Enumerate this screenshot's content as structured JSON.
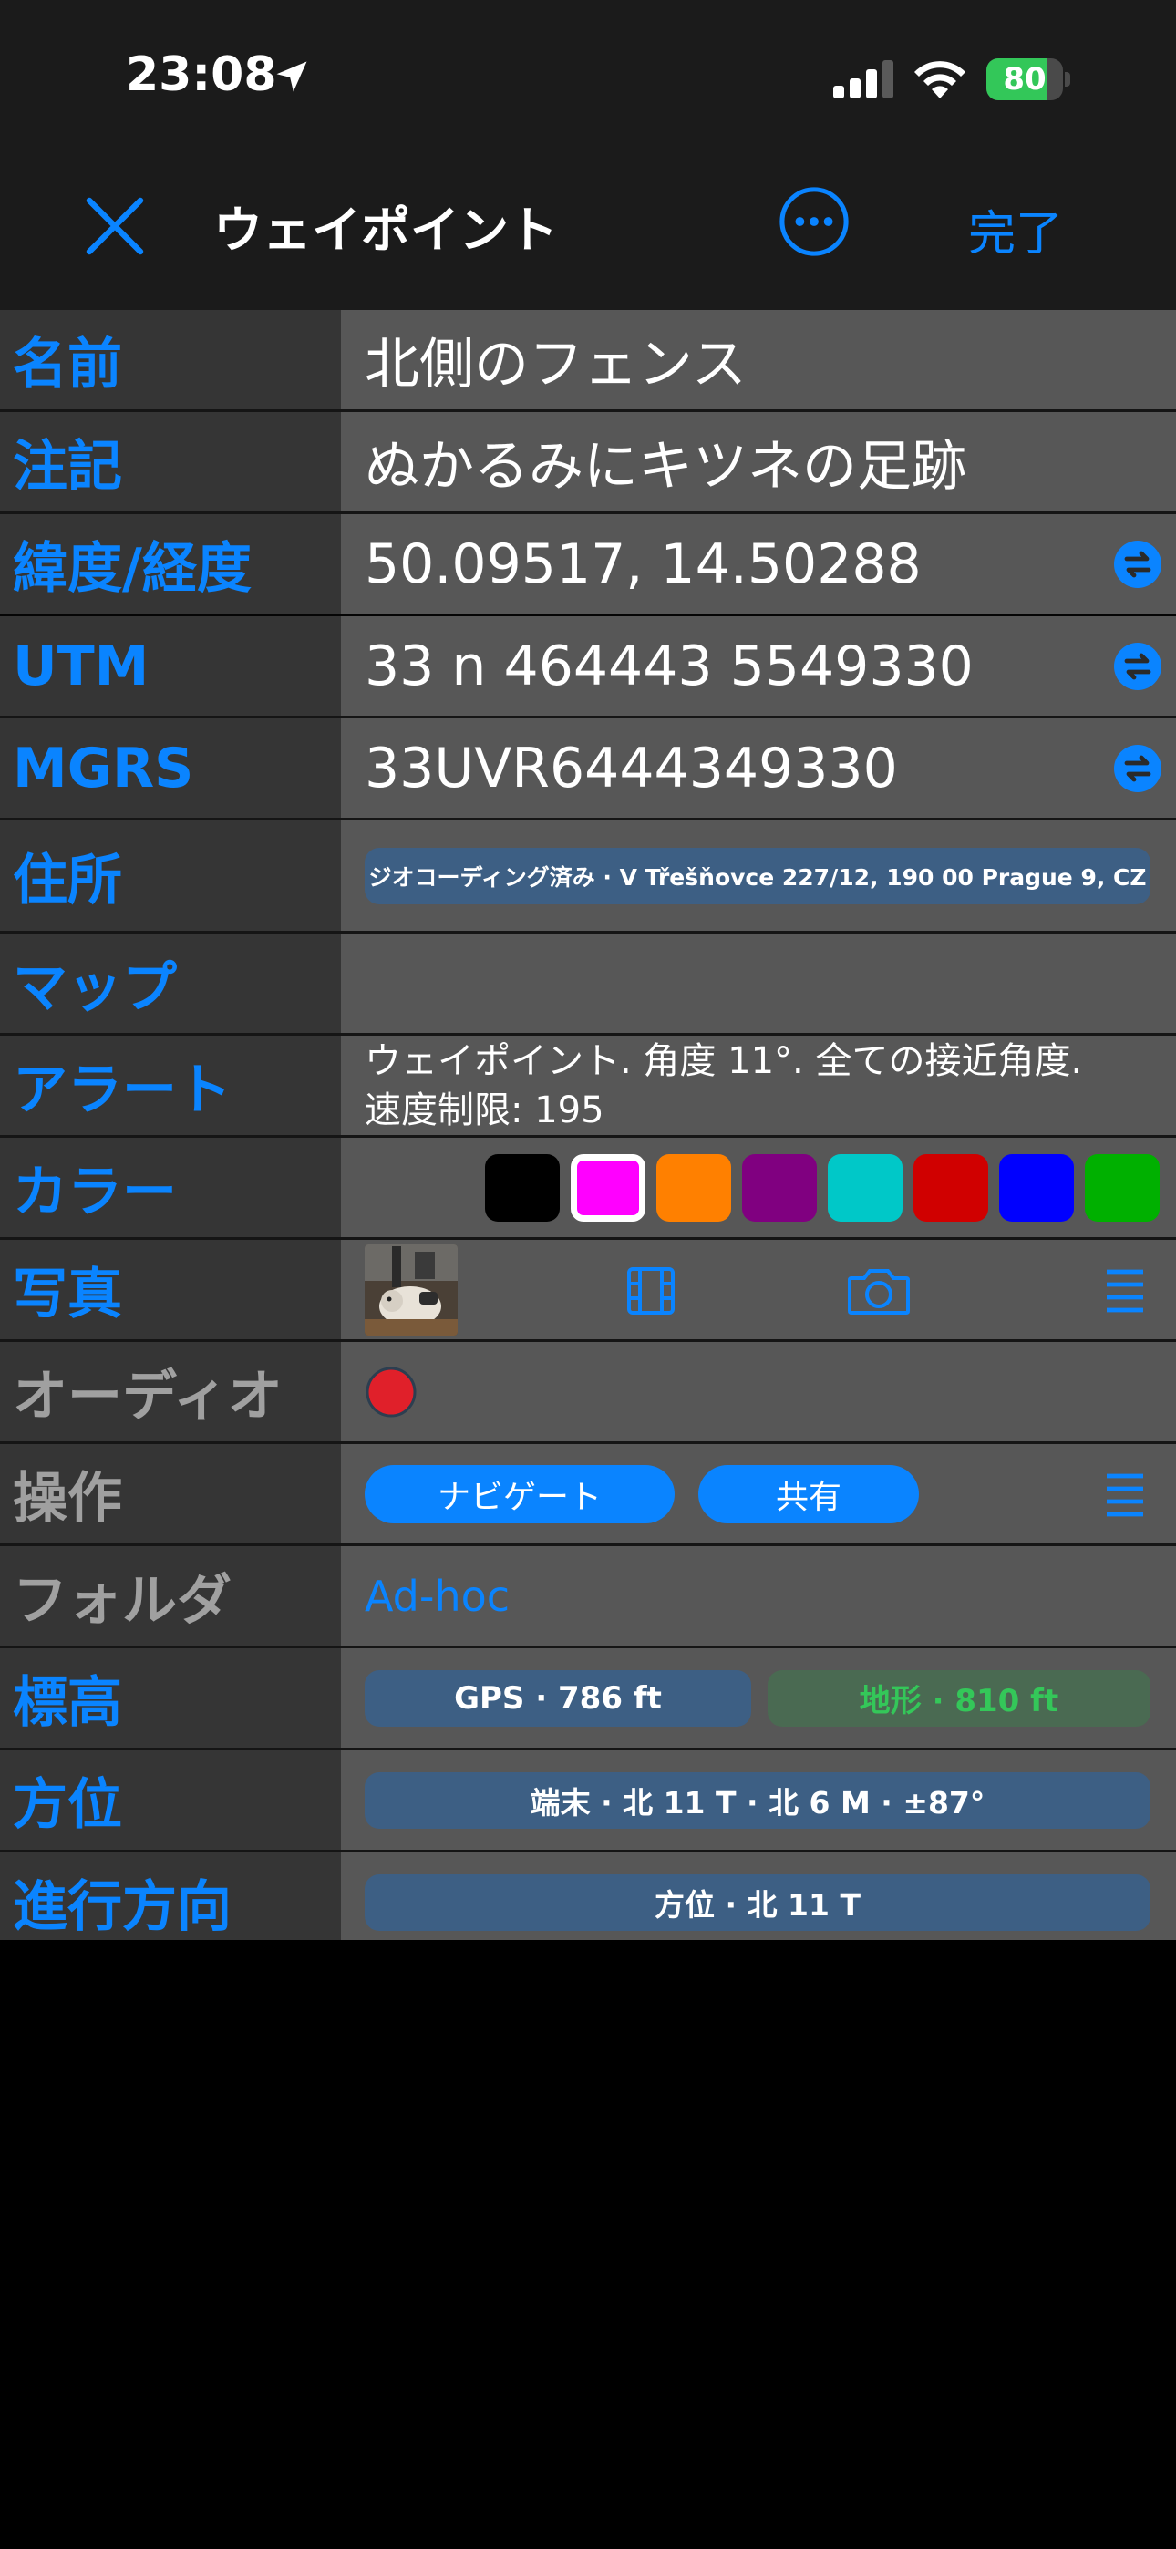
{
  "status_bar": {
    "time": "23:08",
    "battery": "80",
    "battery_level": 0.8,
    "icons": [
      "location-arrow-icon",
      "cellular-signal-icon",
      "wifi-icon",
      "battery-charging-icon"
    ]
  },
  "nav": {
    "title": "ウェイポイント",
    "done": "完了",
    "icons": [
      "close-icon",
      "more-icon"
    ]
  },
  "fields": {
    "name": {
      "label": "名前",
      "value": "北側のフェンス"
    },
    "note": {
      "label": "注記",
      "value": "ぬかるみにキツネの足跡"
    },
    "latlon": {
      "label": "緯度/経度",
      "value": "50.09517, 14.50288"
    },
    "utm": {
      "label": "UTM",
      "value": "33 n 464443 5549330"
    },
    "mgrs": {
      "label": "MGRS",
      "value": "33UVR6444349330"
    },
    "address": {
      "label": "住所",
      "value": "ジオコーディング済み · V Třešňovce 227/12, 190 00 Prague 9, CZ"
    },
    "map": {
      "label": "マップ"
    },
    "alert": {
      "label": "アラート",
      "line1": "ウェイポイント. 角度 11°.  全ての接近角度.",
      "line2": "速度制限: 195"
    },
    "color": {
      "label": "カラー",
      "swatches": [
        "#000000",
        "#ff00ff",
        "#ff8000",
        "#800080",
        "#00c8c8",
        "#d00000",
        "#0000ff",
        "#00b000"
      ],
      "selected": "#ff00ff"
    },
    "photo": {
      "label": "写真",
      "icons": [
        "photo-thumbnail",
        "film-icon",
        "camera-icon",
        "list-icon"
      ]
    },
    "audio": {
      "label": "オーディオ",
      "record_color": "#e0202a"
    },
    "actions": {
      "label": "操作",
      "navigate": "ナビゲート",
      "share": "共有"
    },
    "folder": {
      "label": "フォルダ",
      "value": "Ad-hoc"
    },
    "elevation": {
      "label": "標高",
      "gps": "GPS · 786 ft",
      "terrain": "地形 · 810 ft"
    },
    "bearing": {
      "label": "方位",
      "value": "端末 · 北 11 T · 北 6 M · ±87°"
    },
    "heading": {
      "label": "進行方向",
      "value": "方位 · 北 11 T"
    }
  },
  "colors": {
    "accent": "#0a84ff",
    "label_bg": "#353535",
    "value_bg": "#575757",
    "pill_bg": "#3d5f84",
    "terrain_pill_bg": "#4a6a52",
    "terrain_text": "#34c759"
  }
}
